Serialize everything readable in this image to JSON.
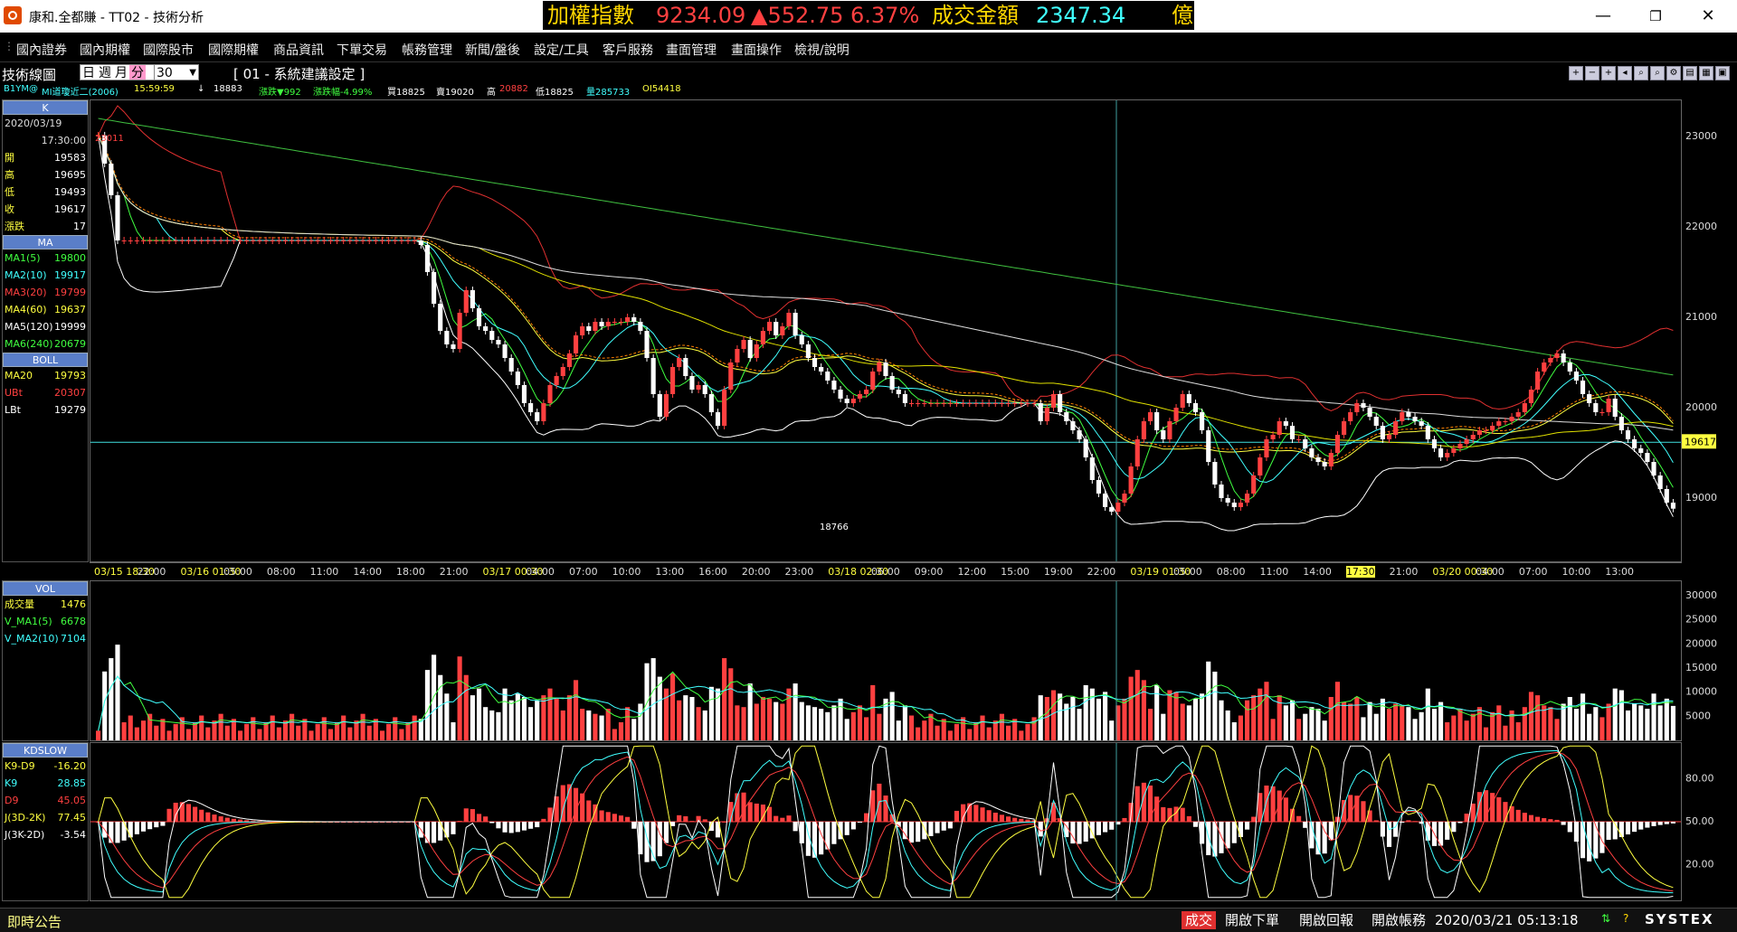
{
  "window": {
    "title": "康和.全都賺 - TT02 - 技術分析",
    "controls": [
      "—",
      "❐",
      "✕"
    ]
  },
  "ticker": {
    "index_label": "加權指數",
    "index_value": "9234.09",
    "change": "▲552.75",
    "change_pct": "6.37%",
    "amount_label": "成交金額",
    "amount_value": "2347.34",
    "amount_unit": "億",
    "colors": {
      "label": "#ffd700",
      "down": "#ff4040",
      "value": "#40ffff"
    }
  },
  "menu": [
    "國內證券",
    "國內期權",
    "國際股市",
    "國際期權",
    "商品資訊",
    "下單交易",
    "帳務管理",
    "新聞/盤後",
    "設定/工具",
    "客戶服務",
    "畫面管理",
    "畫面操作",
    "檢視/說明"
  ],
  "toolbar": {
    "label": "技術線圖",
    "modes": [
      "日",
      "週",
      "月",
      "分"
    ],
    "selected_mode": "分",
    "interval": "30",
    "system": "[ 01 - 系統建議設定 ]"
  },
  "quote": {
    "symbol": "B1YM@",
    "name": "MI道瓊近二(2006)",
    "time": "15:59:59",
    "arrow": "↓",
    "price": "18883",
    "change": "漲跌▼992",
    "change_pct": "漲跌幅-4.99%",
    "buy": "買18825",
    "sell": "賣19020",
    "high_label": "高",
    "high": "20882",
    "low": "低18825",
    "volume": "量285733",
    "oi": "OI54418"
  },
  "panel_k": {
    "header": "K",
    "date": "2020/03/19",
    "time": "17:30:00",
    "rows": [
      {
        "k": "開",
        "v": "19583"
      },
      {
        "k": "高",
        "v": "19695"
      },
      {
        "k": "低",
        "v": "19493"
      },
      {
        "k": "收",
        "v": "19617"
      },
      {
        "k": "漲跌",
        "v": "17"
      }
    ]
  },
  "panel_ma": {
    "header": "MA",
    "rows": [
      {
        "k": "MA1(5)",
        "v": "19800",
        "color": "#40ff40"
      },
      {
        "k": "MA2(10)",
        "v": "19917",
        "color": "#40ffff"
      },
      {
        "k": "MA3(20)",
        "v": "19799",
        "color": "#ff4040"
      },
      {
        "k": "MA4(60)",
        "v": "19637",
        "color": "#ffff40"
      },
      {
        "k": "MA5(120)",
        "v": "19999",
        "color": "#ffffff"
      },
      {
        "k": "MA6(240)",
        "v": "20679",
        "color": "#40ff40"
      }
    ]
  },
  "panel_boll": {
    "header": "BOLL",
    "rows": [
      {
        "k": "MA20",
        "v": "19793",
        "color": "#ffff40"
      },
      {
        "k": "UBt",
        "v": "20307",
        "color": "#ff4040"
      },
      {
        "k": "LBt",
        "v": "19279",
        "color": "#ffffff"
      }
    ]
  },
  "panel_vol": {
    "header": "VOL",
    "rows": [
      {
        "k": "成交量",
        "v": "1476",
        "color": "#ffff40"
      },
      {
        "k": "V_MA1(5)",
        "v": "6678",
        "color": "#40ff40"
      },
      {
        "k": "V_MA2(10)",
        "v": "7104",
        "color": "#40ffff"
      }
    ]
  },
  "panel_kd": {
    "header": "KDSLOW",
    "rows": [
      {
        "k": "K9-D9",
        "v": "-16.20",
        "color": "#ffff40"
      },
      {
        "k": "K9",
        "v": "28.85",
        "color": "#40ffff"
      },
      {
        "k": "D9",
        "v": "45.05",
        "color": "#ff4040"
      },
      {
        "k": "J(3D-2K)",
        "v": "77.45",
        "color": "#ffff40"
      },
      {
        "k": "J(3K-2D)",
        "v": "-3.54",
        "color": "#ffffff"
      }
    ]
  },
  "chart_data": [
    {
      "type": "candlestick",
      "title": "K",
      "y_ticks": [
        23000,
        22000,
        21000,
        20000,
        19000
      ],
      "ylim": [
        18300,
        23400
      ],
      "last_price_marker": 19617,
      "start_price_label": "23011",
      "low_label": "18766",
      "x_ticks": [
        "03/15 18:30",
        "22:00",
        "03/16 01:30",
        "05:00",
        "08:00",
        "11:00",
        "14:00",
        "18:00",
        "21:00",
        "03/17 00:30",
        "04:00",
        "07:00",
        "10:00",
        "13:00",
        "16:00",
        "20:00",
        "23:00",
        "03/18 02:30",
        "06:00",
        "09:00",
        "12:00",
        "15:00",
        "19:00",
        "22:00",
        "03/19 01:30",
        "05:00",
        "08:00",
        "11:00",
        "14:00",
        "17:30",
        "21:00",
        "03/20 00:30",
        "04:00",
        "07:00",
        "10:00",
        "13:00"
      ],
      "x_highlight": "17:30",
      "closes": [
        23011,
        22700,
        22350,
        21850,
        21850,
        21850,
        21850,
        21850,
        21850,
        21850,
        21850,
        21850,
        21850,
        21850,
        21850,
        21850,
        21850,
        21850,
        21850,
        21850,
        21850,
        21850,
        21850,
        21850,
        21850,
        21850,
        21850,
        21850,
        21850,
        21850,
        21850,
        21850,
        21850,
        21850,
        21850,
        21850,
        21850,
        21850,
        21850,
        21850,
        21850,
        21850,
        21850,
        21850,
        21850,
        21850,
        21850,
        21850,
        21850,
        21850,
        21800,
        21500,
        21150,
        20850,
        20700,
        20650,
        21050,
        21300,
        21100,
        20900,
        20850,
        20750,
        20700,
        20550,
        20400,
        20250,
        20050,
        19950,
        19850,
        20050,
        20250,
        20350,
        20450,
        20600,
        20800,
        20900,
        20850,
        20950,
        20900,
        20950,
        20950,
        20950,
        21000,
        20950,
        20850,
        20550,
        20150,
        19900,
        20150,
        20450,
        20550,
        20350,
        20200,
        20250,
        20150,
        19950,
        19800,
        20200,
        20500,
        20650,
        20750,
        20550,
        20700,
        20850,
        20950,
        20800,
        20900,
        21050,
        20800,
        20700,
        20550,
        20450,
        20400,
        20300,
        20200,
        20100,
        20050,
        20100,
        20150,
        20200,
        20400,
        20500,
        20350,
        20200,
        20150,
        20050,
        20050,
        20050,
        20050,
        20050,
        20050,
        20050,
        20050,
        20050,
        20050,
        20050,
        20050,
        20050,
        20050,
        20050,
        20050,
        20050,
        20050,
        20050,
        20050,
        20050,
        19850,
        20000,
        20150,
        19950,
        19850,
        19750,
        19650,
        19450,
        19200,
        19050,
        18900,
        18850,
        18950,
        19050,
        19350,
        19650,
        19850,
        19950,
        19750,
        19650,
        19850,
        20000,
        20150,
        20050,
        19950,
        19750,
        19400,
        19150,
        19000,
        18950,
        18900,
        18950,
        19050,
        19250,
        19450,
        19650,
        19700,
        19850,
        19800,
        19650,
        19650,
        19550,
        19450,
        19400,
        19350,
        19500,
        19700,
        19850,
        19950,
        20050,
        20000,
        19900,
        19800,
        19650,
        19700,
        19850,
        19950,
        19900,
        19850,
        19800,
        19650,
        19550,
        19450,
        19500,
        19550,
        19600,
        19650,
        19700,
        19750,
        19750,
        19800,
        19850,
        19850,
        19900,
        19950,
        20050,
        20200,
        20400,
        20500,
        20550,
        20600,
        20500,
        20400,
        20300,
        20150,
        20050,
        19950,
        19950,
        20100,
        19900,
        19750,
        19650,
        19550,
        19500,
        19400,
        19250,
        19100,
        18950,
        18883
      ]
    },
    {
      "type": "bar",
      "title": "VOL",
      "y_ticks": [
        30000,
        25000,
        20000,
        15000,
        10000,
        5000
      ],
      "ylim": [
        0,
        33000
      ]
    },
    {
      "type": "line",
      "title": "KDSLOW",
      "y_ticks": [
        80,
        50,
        20
      ],
      "ylim": [
        -5,
        105
      ]
    }
  ],
  "status": {
    "announcement": "即時公告",
    "buttons": [
      "成交",
      "開啟下單",
      "開啟回報",
      "開啟帳務"
    ],
    "datetime": "2020/03/21 05:13:18",
    "brand": "SYSTEX"
  }
}
